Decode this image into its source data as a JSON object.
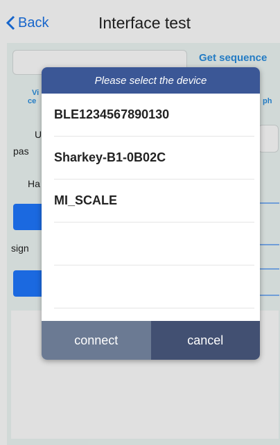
{
  "header": {
    "back_label": "Back",
    "title": "Interface test"
  },
  "background": {
    "get_sequence_label": "Get sequence",
    "fragments": [
      "Vi",
      "ce",
      "ph",
      "U",
      "pas",
      "Ha",
      "sign"
    ]
  },
  "dialog": {
    "title": "Please select the device",
    "devices": [
      "BLE1234567890130",
      "Sharkey-B1-0B02C",
      "MI_SCALE",
      "",
      ""
    ],
    "connect_label": "connect",
    "cancel_label": "cancel"
  },
  "colors": {
    "accent": "#1a73e8",
    "dialog_header": "#3b5796",
    "connect_button": "#6b7a93",
    "cancel_button": "#425072"
  }
}
